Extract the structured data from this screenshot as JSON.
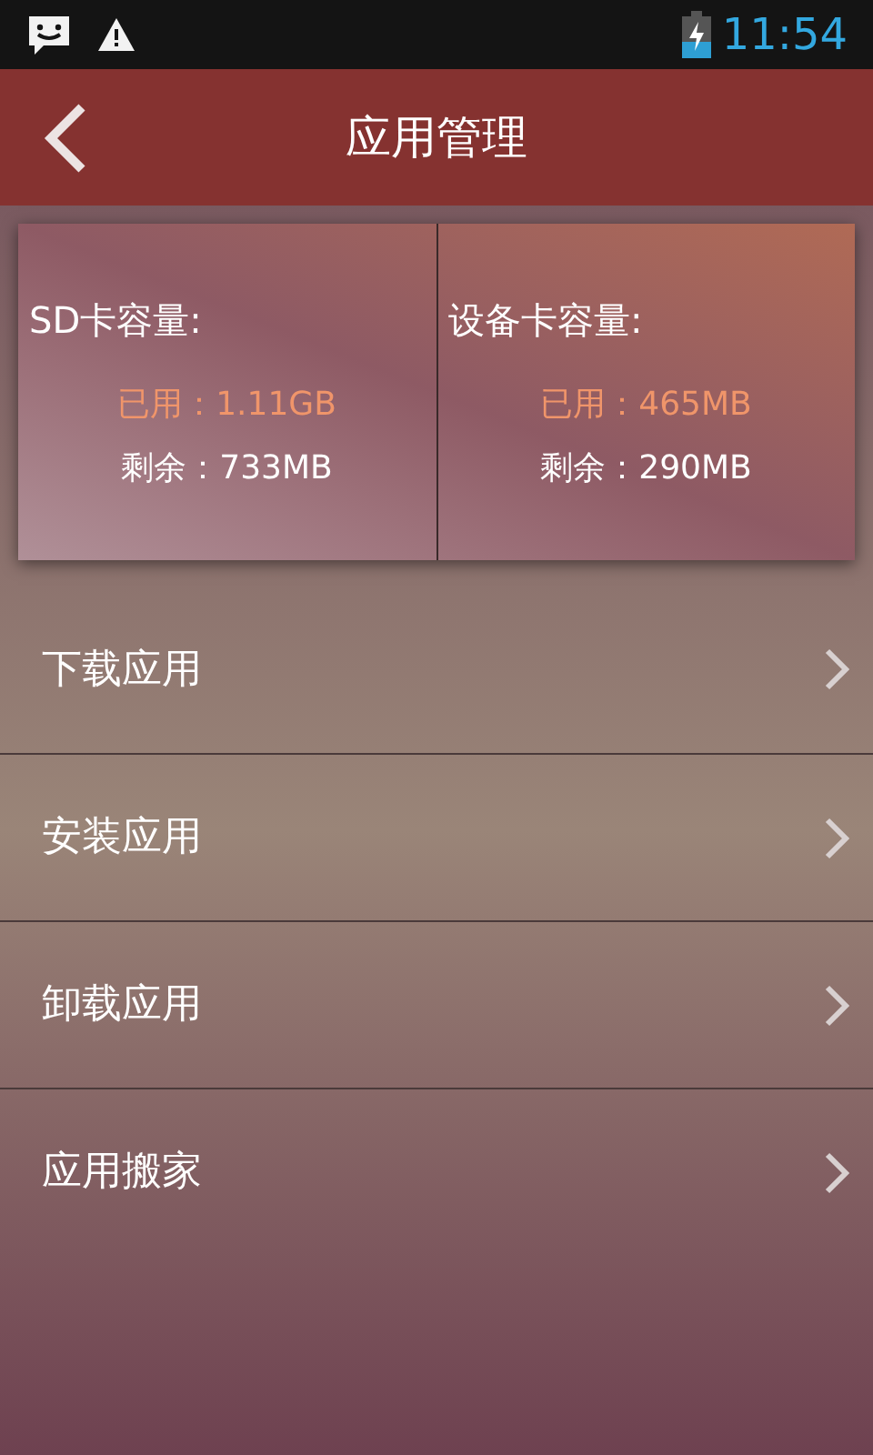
{
  "status_bar": {
    "time": "11:54"
  },
  "header": {
    "title": "应用管理"
  },
  "storage": [
    {
      "title": "SD卡容量:",
      "used": "已用：1.11GB",
      "remaining": "剩余：733MB"
    },
    {
      "title": "设备卡容量:",
      "used": "已用：465MB",
      "remaining": "剩余：290MB"
    }
  ],
  "menu": [
    {
      "label": "下载应用"
    },
    {
      "label": "安装应用"
    },
    {
      "label": "卸载应用"
    },
    {
      "label": "应用搬家"
    }
  ]
}
